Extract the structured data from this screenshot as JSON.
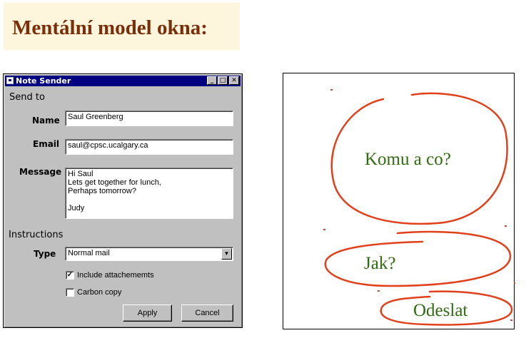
{
  "slide": {
    "title": "Mentální model okna:"
  },
  "window": {
    "title": "Note Sender",
    "controls": {
      "minimize": "_",
      "maximize": "□",
      "close": "✕"
    },
    "send_to_label": "Send to",
    "name_label": "Name",
    "name_value": "Saul Greenberg",
    "email_label": "Email",
    "email_value": "saul@cpsc.ucalgary.ca",
    "message_label": "Message",
    "message_value": "Hi Saul\nLets get together for lunch,\nPerhaps tomorrow?\n\nJudy",
    "instructions_label": "Instructions",
    "type_label": "Type",
    "type_value": "Normal mail",
    "include_attachments_label": "Include attachememts",
    "include_attachments_checked": true,
    "carbon_copy_label": "Carbon copy",
    "carbon_copy_checked": false,
    "apply_label": "Apply",
    "cancel_label": "Cancel"
  },
  "sketch": {
    "who_what": "Komu a co?",
    "how": "Jak?",
    "send": "Odeslat",
    "stroke_color": "#e0401a",
    "text_color": "#2f6b10"
  }
}
